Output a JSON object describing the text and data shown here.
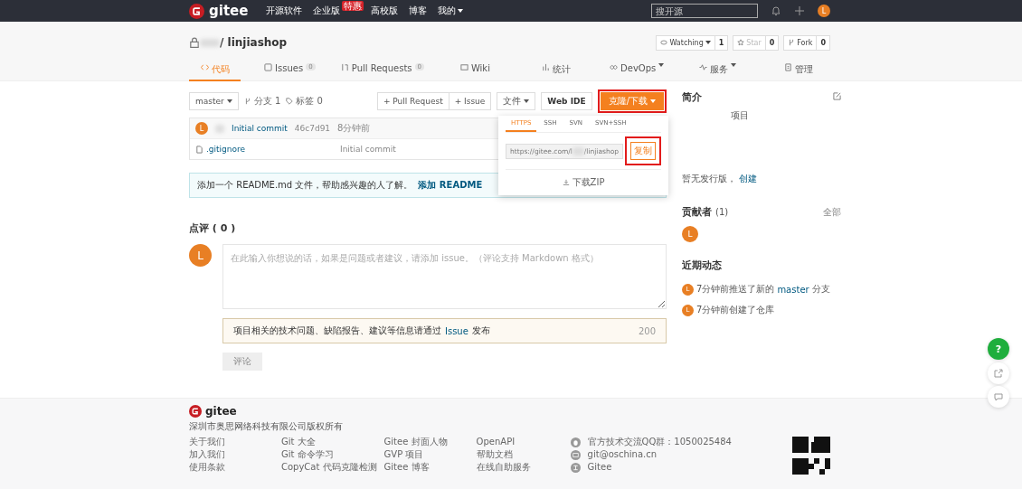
{
  "nav": {
    "logo": "gitee",
    "links": [
      {
        "label": "开源软件"
      },
      {
        "label": "企业版",
        "badge": "特惠"
      },
      {
        "label": "高校版"
      },
      {
        "label": "博客"
      }
    ],
    "menu": "我的",
    "search": {
      "placeholder": "搜开源"
    },
    "avatar": "L"
  },
  "repo": {
    "locked": true,
    "name": "/ linjiashop",
    "actions": [
      {
        "label": "Watching",
        "count": "1",
        "kind": "watch",
        "disabled": false
      },
      {
        "label": "Star",
        "count": "0",
        "kind": "star",
        "disabled": true
      },
      {
        "label": "Fork",
        "count": "0",
        "kind": "fork",
        "disabled": false
      }
    ],
    "tabs": [
      {
        "label": "代码",
        "kind": "code",
        "selected": true
      },
      {
        "label": "Issues",
        "kind": "issues",
        "count": "0",
        "selected": false
      },
      {
        "label": "Pull Requests",
        "kind": "pr",
        "count": "0",
        "selected": false
      },
      {
        "label": "Wiki",
        "kind": "wiki",
        "selected": false
      },
      {
        "label": "统计",
        "kind": "stats",
        "selected": false
      },
      {
        "label": "DevOps",
        "kind": "devops",
        "dropdown": true,
        "selected": false
      },
      {
        "label": "服务",
        "kind": "service",
        "dropdown": true,
        "selected": false
      },
      {
        "label": "管理",
        "kind": "manage",
        "selected": false
      }
    ]
  },
  "toolbar": {
    "branch": "master",
    "branches": "分支 1",
    "tags": "标签 0",
    "buttons": [
      {
        "label": "+ Pull Request",
        "kind": "group"
      },
      {
        "label": "+ Issue",
        "kind": "group"
      },
      {
        "label": "文件",
        "kind": "menu"
      },
      {
        "label": "Web IDE",
        "kind": "bold"
      },
      {
        "label": "克隆/下载",
        "kind": "primary",
        "highlighted": true
      }
    ]
  },
  "clone": {
    "tabs": [
      {
        "label": "HTTPS",
        "selected": true
      },
      {
        "label": "SSH",
        "selected": false
      },
      {
        "label": "SVN",
        "selected": false
      },
      {
        "label": "SVN+SSH",
        "selected": false
      }
    ],
    "url_start": "https://gitee.com/l",
    "url_end": "/linjiashop",
    "copy": {
      "label": "复制",
      "highlighted": true
    },
    "download": "下载ZIP"
  },
  "commit": {
    "message": "Initial commit",
    "hash": "46c7d91",
    "time": "8分钟前",
    "avatar": "L"
  },
  "files": [
    {
      "name": ".gitignore",
      "message": "Initial commit"
    }
  ],
  "readme": {
    "text": "添加一个 README.md 文件，帮助感兴趣的人了解。",
    "link": "添加 README"
  },
  "comments": {
    "title": "点评 ( 0 )",
    "avatar": "L",
    "placeholder": "在此输入你想说的话，如果是问题或者建议，请添加 issue。（评论支持 Markdown 格式）",
    "notice": "项目相关的技术问题、缺陷报告、建议等信息请通过",
    "notice_link": "Issue",
    "notice_end": "发布",
    "limit": "200",
    "submit": {
      "label": "评论",
      "disabled": true
    }
  },
  "sidebar": {
    "intro": {
      "title": "简介",
      "text": "项目"
    },
    "release": {
      "text": "暂无发行版，",
      "link": "创建"
    },
    "contributors": {
      "title": "贡献者",
      "count": "(1)",
      "all": "全部",
      "avatars": [
        "L"
      ]
    },
    "activity": {
      "title": "近期动态",
      "items": [
        {
          "avatar": "L",
          "text": "7分钟前推送了新的",
          "link": "master",
          "end": "分支"
        },
        {
          "avatar": "L",
          "text": "7分钟前创建了仓库"
        }
      ]
    }
  },
  "float_buttons": [
    {
      "kind": "help",
      "label": "?"
    },
    {
      "kind": "share"
    },
    {
      "kind": "chat"
    }
  ],
  "footer": {
    "logo": "gitee",
    "company": "深圳市奥思网络科技有限公司版权所有",
    "columns": [
      [
        "关于我们",
        "加入我们",
        "使用条款"
      ],
      [
        "Git 大全",
        "Git 命令学习",
        "CopyCat 代码克隆检测"
      ],
      [
        "Gitee 封面人物",
        "GVP 项目",
        "Gitee 博客"
      ],
      [
        "OpenAPI",
        "帮助文档",
        "在线自助服务"
      ]
    ],
    "contacts": [
      {
        "kind": "qq",
        "text": "官方技术交流QQ群：1050025484"
      },
      {
        "kind": "mail",
        "text": "git@oschina.cn"
      },
      {
        "kind": "zhihu",
        "text": "Gitee"
      }
    ]
  }
}
